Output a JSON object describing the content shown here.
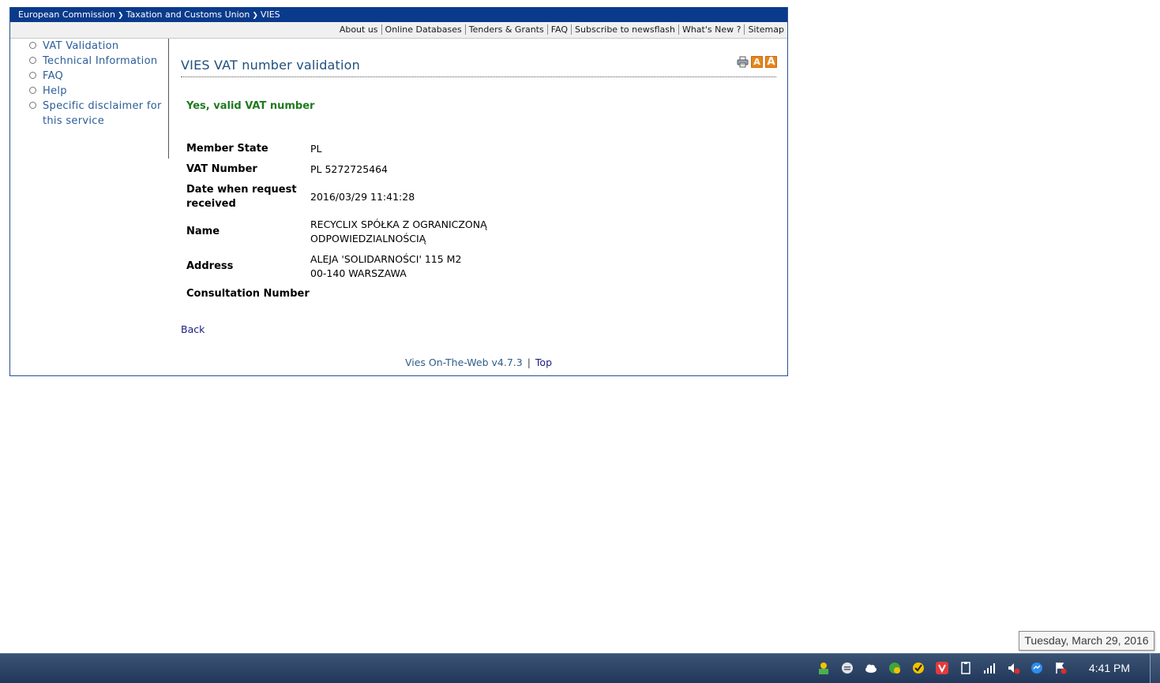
{
  "breadcrumb": {
    "items": [
      "European Commission",
      "Taxation and Customs Union",
      "VIES"
    ]
  },
  "toplinks": [
    "About us",
    "Online Databases",
    "Tenders & Grants",
    "FAQ",
    "Subscribe to newsflash",
    "What's New ?",
    "Sitemap"
  ],
  "sidebar": {
    "items": [
      {
        "label": "VAT Validation"
      },
      {
        "label": "Technical Information"
      },
      {
        "label": "FAQ"
      },
      {
        "label": "Help"
      },
      {
        "label": "Specific disclaimer for this service"
      }
    ]
  },
  "main": {
    "title": "VIES VAT number validation",
    "tools": {
      "print_icon": "printer-icon",
      "font_small_icon": "font-size-small-icon",
      "font_large_icon": "font-size-large-icon",
      "font_icon_letter": "A",
      "font_icon_color": "#e8861c"
    },
    "result_message": "Yes, valid VAT number",
    "result_color": "#1f7a1f",
    "details": {
      "member_state": {
        "label": "Member State",
        "value": "PL"
      },
      "vat_number": {
        "label": "VAT Number",
        "value": "PL 5272725464"
      },
      "date_received": {
        "label": "Date when request received",
        "value": "2016/03/29 11:41:28"
      },
      "name": {
        "label": "Name",
        "value_line1": "RECYCLIX SPÓŁKA Z OGRANICZONĄ",
        "value_line2": "ODPOWIEDZIALNOŚCIĄ"
      },
      "address": {
        "label": "Address",
        "value_line1": "ALEJA 'SOLIDARNOŚCI' 115 M2",
        "value_line2": "00-140 WARSZAWA"
      },
      "consultation_number": {
        "label": "Consultation Number",
        "value": ""
      }
    },
    "back_label": "Back",
    "footer": {
      "version": "Vies On-The-Web v4.7.3",
      "separator": "|",
      "top_label": "Top"
    }
  },
  "taskbar": {
    "tooltip": "Tuesday, March 29, 2016",
    "clock": "4:41 PM",
    "tray_icons": [
      "app-icon",
      "messenger-chat-icon",
      "onedrive-cloud-icon",
      "security-icon",
      "norton-icon",
      "vivaldi-icon",
      "clipboard-icon",
      "network-signal-icon",
      "volume-muted-icon",
      "messenger-icon",
      "action-center-flag-icon"
    ]
  },
  "colors": {
    "header_bar": "#0a3a8c",
    "link": "#2b5c98",
    "title": "#1f4f7c",
    "taskbar": "#2c4466"
  }
}
